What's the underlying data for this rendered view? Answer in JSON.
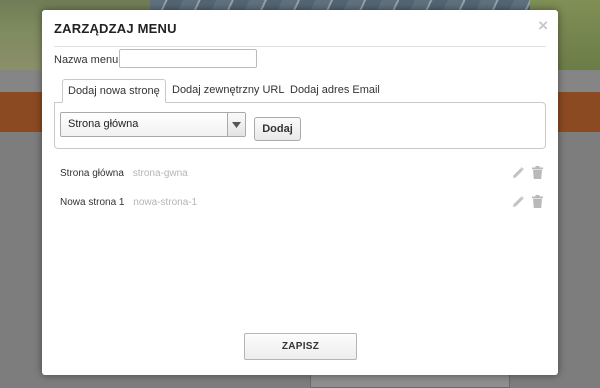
{
  "modal": {
    "title": "ZARZĄDZAJ MENU",
    "close_glyph": "×"
  },
  "form": {
    "name_label": "Nazwa menu:",
    "name_value": "",
    "name_placeholder": ""
  },
  "tabs": [
    {
      "label": "Dodaj nowa stronę",
      "active": true
    },
    {
      "label": "Dodaj zewnętrzny URL",
      "active": false
    },
    {
      "label": "Dodaj adres Email",
      "active": false
    }
  ],
  "page_select": {
    "selected": "Strona główna"
  },
  "add_button": "Dodaj",
  "menu_items": [
    {
      "name": "Strona główna",
      "slug": "strona-gwna"
    },
    {
      "name": "Nowa strona 1",
      "slug": "nowa-strona-1"
    }
  ],
  "icons": {
    "edit": "pencil-icon",
    "delete": "trash-icon",
    "close": "close-icon",
    "dropdown": "chevron-down-icon"
  },
  "save_button": "ZAPISZ",
  "colors": {
    "overlay_bg": "#8a8a8a",
    "modal_bg": "#ffffff",
    "slug_text": "#b5b5b5",
    "icon_gray": "#b9b9b9"
  }
}
